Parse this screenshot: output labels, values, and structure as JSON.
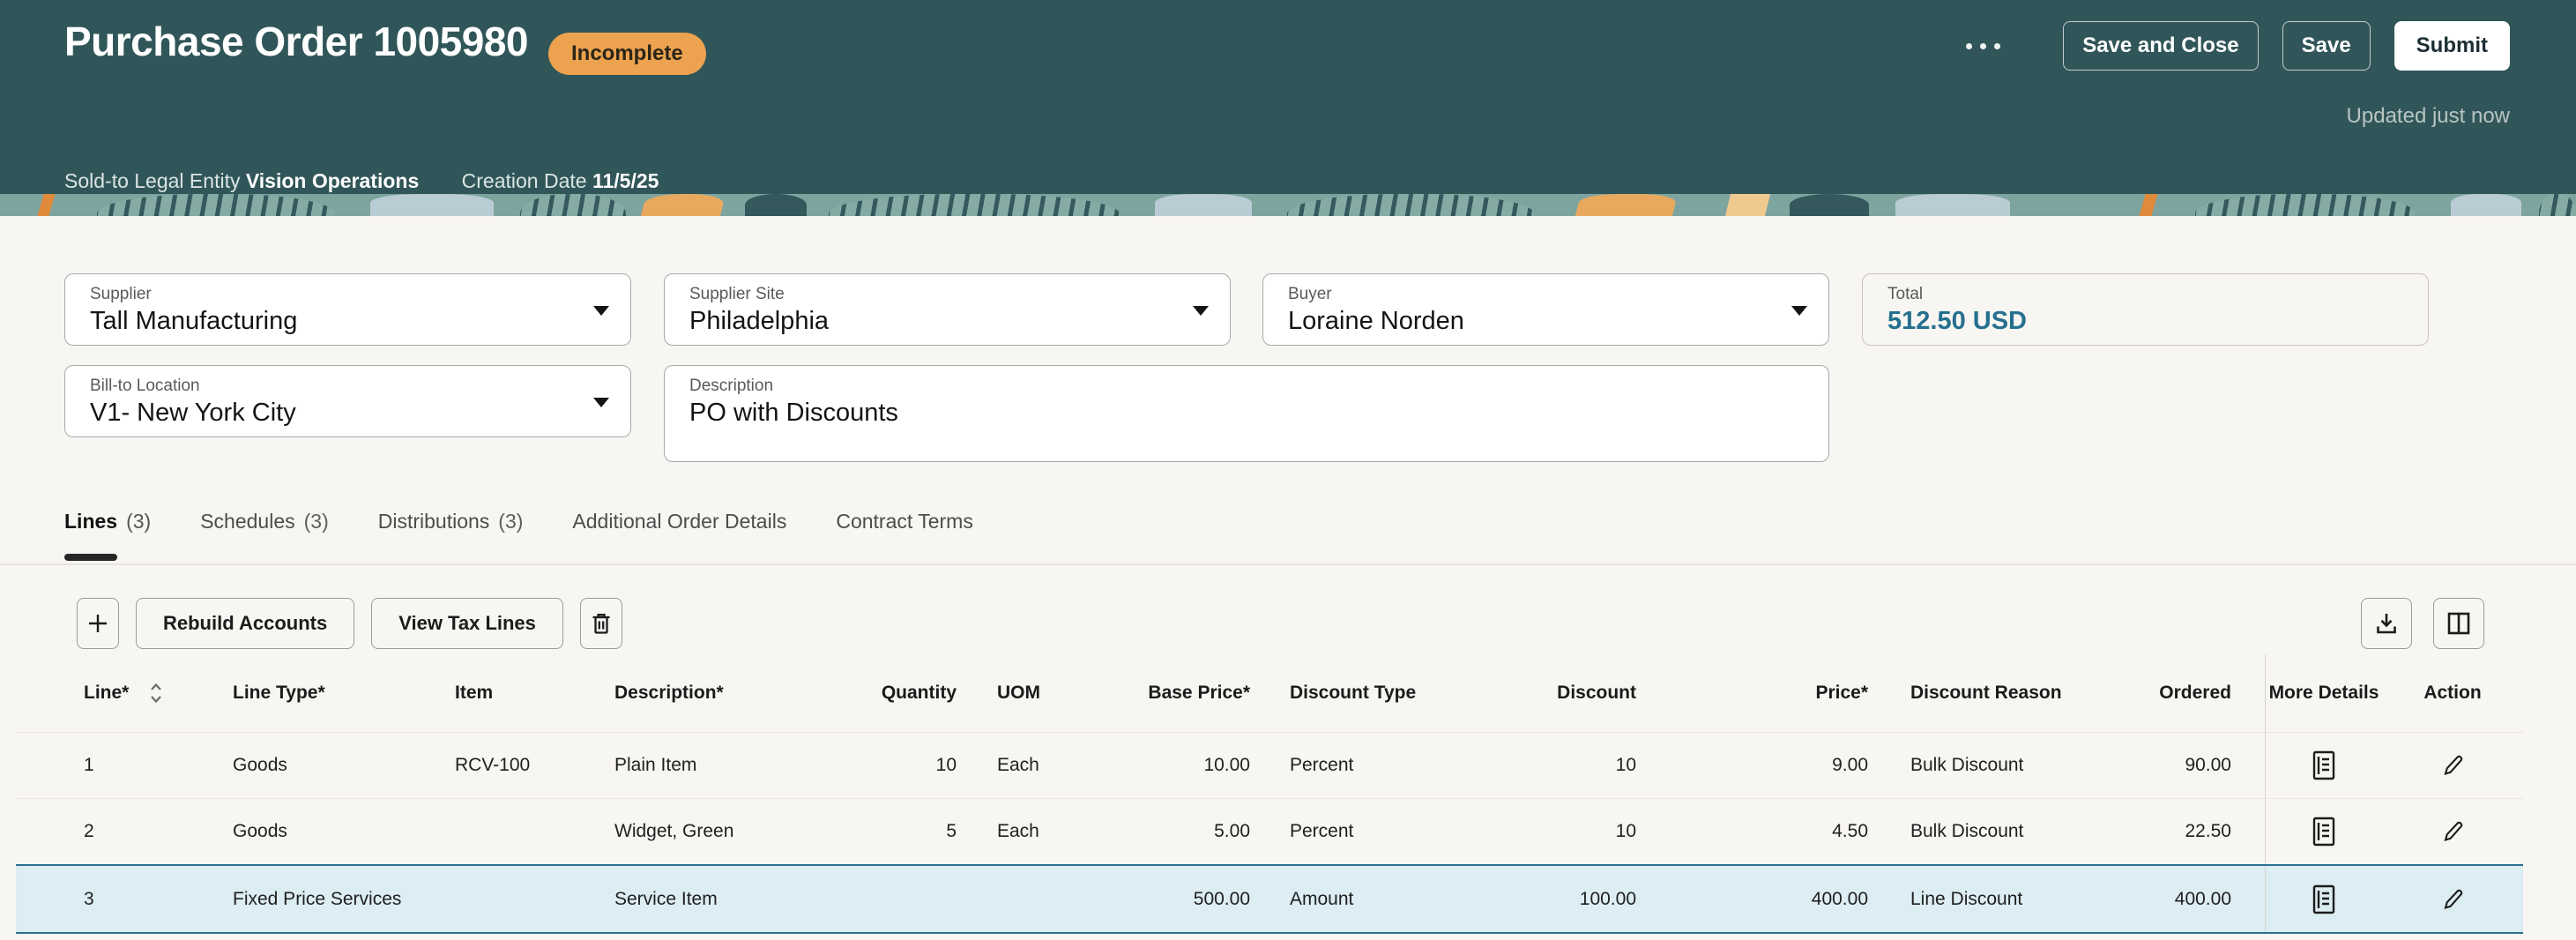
{
  "header": {
    "title": "Purchase Order 1005980",
    "status_badge": "Incomplete",
    "buttons": {
      "save_and_close": "Save and Close",
      "save": "Save",
      "submit": "Submit"
    },
    "updated": "Updated just now",
    "sold_to_label": "Sold-to Legal Entity",
    "sold_to_value": "Vision Operations",
    "creation_date_label": "Creation Date",
    "creation_date_value": "11/5/25"
  },
  "fields": {
    "supplier": {
      "label": "Supplier",
      "value": "Tall Manufacturing"
    },
    "supplier_site": {
      "label": "Supplier Site",
      "value": "Philadelphia"
    },
    "buyer": {
      "label": "Buyer",
      "value": "Loraine Norden"
    },
    "total": {
      "label": "Total",
      "value": "512.50 USD"
    },
    "bill_to_location": {
      "label": "Bill-to Location",
      "value": "V1- New York City"
    },
    "description": {
      "label": "Description",
      "value": "PO with Discounts"
    }
  },
  "tabs": [
    {
      "label": "Lines",
      "count": "(3)"
    },
    {
      "label": "Schedules",
      "count": "(3)"
    },
    {
      "label": "Distributions",
      "count": "(3)"
    },
    {
      "label": "Additional Order Details",
      "count": ""
    },
    {
      "label": "Contract Terms",
      "count": ""
    }
  ],
  "toolbar": {
    "rebuild_accounts": "Rebuild Accounts",
    "view_tax_lines": "View Tax Lines"
  },
  "icons": {
    "ellipsis": "more-actions",
    "add": "add-line",
    "delete": "delete-line",
    "download": "export",
    "manage_columns": "manage-columns",
    "sort": "sort-line-column",
    "more_details": "more-details-document",
    "edit": "edit-pencil",
    "caret": "dropdown-caret"
  },
  "table": {
    "columns": {
      "line": "Line*",
      "line_type": "Line Type*",
      "item": "Item",
      "description": "Description*",
      "quantity": "Quantity",
      "uom": "UOM",
      "base_price": "Base Price*",
      "discount_type": "Discount Type",
      "discount": "Discount",
      "price": "Price*",
      "discount_reason": "Discount Reason",
      "ordered": "Ordered",
      "more_details": "More Details",
      "action": "Action"
    },
    "rows": [
      {
        "line": "1",
        "line_type": "Goods",
        "item": "RCV-100",
        "description": "Plain Item",
        "quantity": "10",
        "uom": "Each",
        "base_price": "10.00",
        "discount_type": "Percent",
        "discount": "10",
        "price": "9.00",
        "discount_reason": "Bulk Discount",
        "ordered": "90.00"
      },
      {
        "line": "2",
        "line_type": "Goods",
        "item": "",
        "description": "Widget, Green",
        "quantity": "5",
        "uom": "Each",
        "base_price": "5.00",
        "discount_type": "Percent",
        "discount": "10",
        "price": "4.50",
        "discount_reason": "Bulk Discount",
        "ordered": "22.50"
      },
      {
        "line": "3",
        "line_type": "Fixed Price Services",
        "item": "",
        "description": "Service Item",
        "quantity": "",
        "uom": "",
        "base_price": "500.00",
        "discount_type": "Amount",
        "discount": "100.00",
        "price": "400.00",
        "discount_reason": "Line Discount",
        "ordered": "400.00"
      }
    ],
    "selected_row_index": 2
  },
  "colors": {
    "header_bg": "#315659",
    "badge_bg": "#eca24f",
    "selected_row_bg": "#dcedf3",
    "selected_row_border": "#2a7090",
    "total_value": "#26708f",
    "page_bg": "#f8f6f2"
  }
}
